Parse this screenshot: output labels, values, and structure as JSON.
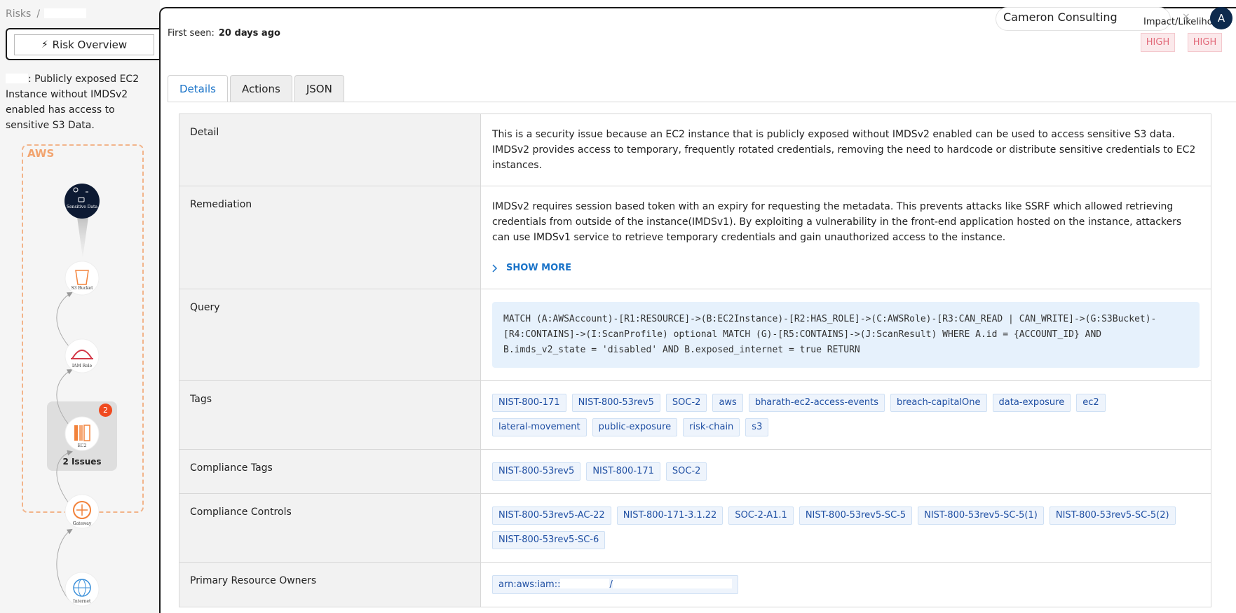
{
  "breadcrumb": {
    "root": "Risks",
    "separator": "/"
  },
  "sidebar": {
    "risk_overview_label": "Risk Overview",
    "risk_description": ": Publicly exposed EC2 Instance without IMDSv2 enabled has access to sensitive S3 Data.",
    "cloud_label": "AWS",
    "nodes": [
      {
        "caption": "Sensitive Data",
        "icon": "sensitive-data-icon"
      },
      {
        "caption": "S3 Bucket",
        "icon": "s3-bucket-icon"
      },
      {
        "caption": "IAM Role",
        "icon": "iam-role-icon"
      },
      {
        "caption": "EC2",
        "icon": "ec2-icon"
      },
      {
        "caption": "Gateway",
        "icon": "gateway-icon"
      },
      {
        "caption": "Internet",
        "icon": "internet-icon"
      }
    ],
    "issues_badge": "2",
    "issues_label": "2 Issues"
  },
  "header": {
    "first_seen_label": "First seen:",
    "first_seen_value": "20 days ago",
    "org_name": "Cameron Consulting",
    "clear_icon": "×",
    "impact_label": "Impact/Likelihood",
    "avatar_initial": "A",
    "impact": "HIGH",
    "likelihood": "HIGH"
  },
  "tabs": [
    {
      "label": "Details",
      "active": true
    },
    {
      "label": "Actions",
      "active": false
    },
    {
      "label": "JSON",
      "active": false
    }
  ],
  "details": {
    "detail_label": "Detail",
    "detail_text": "This is a security issue because an EC2 instance that is publicly exposed without IMDSv2 enabled can be used to access sensitive S3 data. IMDSv2 provides access to temporary, frequently rotated credentials, removing the need to hardcode or distribute sensitive credentials to EC2 instances.",
    "remediation_label": "Remediation",
    "remediation_text": "IMDSv2 requires session based token with an expiry for requesting the metadata. This prevents attacks like SSRF which allowed retrieving credentials from outside of the instance(IMDSv1). By exploiting a vulnerability in the front-end application hosted on the instance, attackers can use IMDSv1 service to retrieve temporary credentials and gain unauthorized access to the instance.",
    "show_more_label": "SHOW MORE",
    "query_label": "Query",
    "query_text": "MATCH (A:AWSAccount)-[R1:RESOURCE]->(B:EC2Instance)-[R2:HAS_ROLE]->(C:AWSRole)-[R3:CAN_READ | CAN_WRITE]->(G:S3Bucket)-[R4:CONTAINS]->(I:ScanProfile) optional MATCH (G)-[R5:CONTAINS]->(J:ScanResult) WHERE A.id = {ACCOUNT_ID} AND B.imds_v2_state = 'disabled' AND B.exposed_internet = true RETURN",
    "tags_label": "Tags",
    "tags": [
      "NIST-800-171",
      "NIST-800-53rev5",
      "SOC-2",
      "aws",
      "bharath-ec2-access-events",
      "breach-capitalOne",
      "data-exposure",
      "ec2",
      "lateral-movement",
      "public-exposure",
      "risk-chain",
      "s3"
    ],
    "compliance_tags_label": "Compliance Tags",
    "compliance_tags": [
      "NIST-800-53rev5",
      "NIST-800-171",
      "SOC-2"
    ],
    "compliance_controls_label": "Compliance Controls",
    "compliance_controls": [
      "NIST-800-53rev5-AC-22",
      "NIST-800-171-3.1.22",
      "SOC-2-A1.1",
      "NIST-800-53rev5-SC-5",
      "NIST-800-53rev5-SC-5(1)",
      "NIST-800-53rev5-SC-5(2)",
      "NIST-800-53rev5-SC-6"
    ],
    "owners_label": "Primary Resource Owners",
    "owner_prefix": "arn:aws:iam::",
    "owner_sep": "/"
  },
  "colors": {
    "accent": "#1a73c8",
    "severity": "#e26a7a",
    "aws": "#f2a46f",
    "badge": "#f04a1f"
  }
}
